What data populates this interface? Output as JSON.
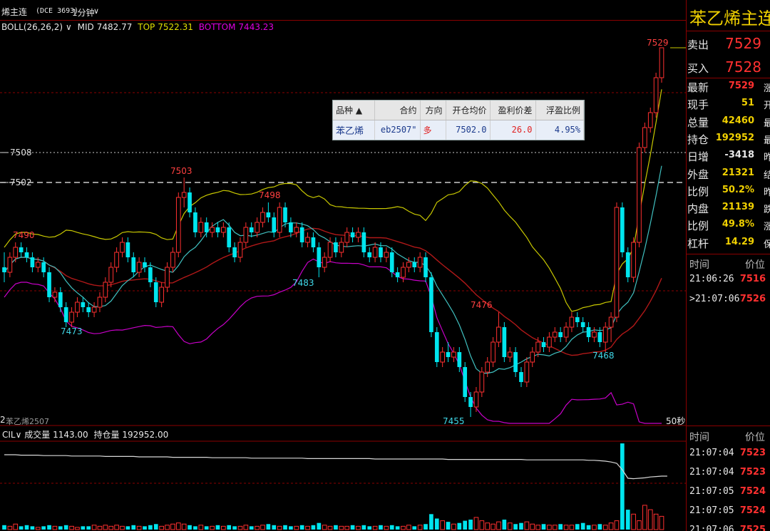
{
  "header": {
    "title": "烯主连",
    "code": "(DCE 3693)",
    "period": "1分钟",
    "chevron": "∨"
  },
  "indicators": {
    "boll_name": "BOLL(26,26,2)",
    "boll_chev": "∨",
    "mid_label": "MID",
    "mid_value": "7482.77",
    "top_label": "TOP",
    "top_value": "7522.31",
    "bottom_label": "BOTTOM",
    "bottom_value": "7443.23"
  },
  "price_levels": {
    "line1": "7508",
    "line2": "7502"
  },
  "annotations": {
    "a7503": "7503",
    "a7498": "7498",
    "a7490": "7490",
    "a7483": "7483",
    "a7476": "7476",
    "a7473": "7473",
    "a7468": "7468",
    "a7455": "7455",
    "a7529": "7529"
  },
  "chart_footer": {
    "left_label": "苯乙烯2507",
    "left_prefix": "2",
    "right_label": "50秒"
  },
  "volume_panel": {
    "prefix": "CIL∨",
    "vol_label": "成交量",
    "vol_value": "1143.00",
    "oi_label": "持仓量",
    "oi_value": "192952.00"
  },
  "position_table": {
    "headers": [
      "品种 ▲",
      "合约",
      "方向",
      "开仓均价",
      "盈利价差",
      "浮盈比例"
    ],
    "row": [
      "苯乙烯",
      "eb2507\"",
      "多",
      "7502.0",
      "26.0",
      "4.95%"
    ]
  },
  "quote_panel": {
    "title": "苯乙烯主连",
    "sell_label": "卖出",
    "sell_price": "7529",
    "buy_label": "买入",
    "buy_price": "7528",
    "rows": [
      {
        "label": "最新",
        "value": "7529",
        "cut": "涨"
      },
      {
        "label": "现手",
        "value": "51",
        "cut": "开"
      },
      {
        "label": "总量",
        "value": "42460",
        "cut": "最"
      },
      {
        "label": "持仓",
        "value": "192952",
        "cut": "最"
      },
      {
        "label": "日增",
        "value": "-3418",
        "cut": "昨"
      },
      {
        "label": "外盘",
        "value": "21321",
        "cut": "结"
      },
      {
        "label": "比例",
        "value": "50.2%",
        "cut": "昨"
      },
      {
        "label": "内盘",
        "value": "21139",
        "cut": "跌"
      },
      {
        "label": "比例",
        "value": "49.8%",
        "cut": "涨"
      },
      {
        "label": "杠杆",
        "value": "14.29",
        "cut": "保"
      }
    ],
    "tick_header": {
      "time": "时间",
      "price": "价位"
    },
    "ticks_top": [
      {
        "time": "21:06:26",
        "price": "7516"
      },
      {
        "time": ">21:07:06",
        "price": "7526"
      }
    ],
    "tick_header2": {
      "time": "时间",
      "price": "价位"
    },
    "ticks_bottom": [
      {
        "time": "21:07:04",
        "price": "7523"
      },
      {
        "time": "21:07:04",
        "price": "7523"
      },
      {
        "time": "21:07:05",
        "price": "7524"
      },
      {
        "time": "21:07:05",
        "price": "7524"
      },
      {
        "time": "21:07:06",
        "price": "7525"
      }
    ]
  },
  "colors": {
    "up": "#ff3030",
    "down": "#00e5ee",
    "mid": "#b01818",
    "top_band": "#c8c800",
    "bottom_band": "#c800c8",
    "fast_ma": "#40c0c0",
    "grid": "#8b0000"
  },
  "chart_data": {
    "type": "candlestick",
    "period": "1分钟",
    "candles": [
      [
        7485,
        7484,
        7488,
        7482
      ],
      [
        7484,
        7487,
        7488,
        7483
      ],
      [
        7487,
        7489,
        7490,
        7486
      ],
      [
        7489,
        7488,
        7490,
        7487
      ],
      [
        7488,
        7487,
        7489,
        7486
      ],
      [
        7487,
        7485,
        7488,
        7484
      ],
      [
        7485,
        7486,
        7487,
        7484
      ],
      [
        7486,
        7484,
        7487,
        7483
      ],
      [
        7484,
        7479,
        7485,
        7478
      ],
      [
        7479,
        7480,
        7481,
        7478
      ],
      [
        7480,
        7477,
        7481,
        7476
      ],
      [
        7477,
        7474,
        7478,
        7473
      ],
      [
        7474,
        7476,
        7477,
        7473
      ],
      [
        7476,
        7478,
        7479,
        7475
      ],
      [
        7478,
        7477,
        7479,
        7476
      ],
      [
        7477,
        7476,
        7478,
        7475
      ],
      [
        7476,
        7477,
        7478,
        7475
      ],
      [
        7477,
        7479,
        7480,
        7476
      ],
      [
        7479,
        7482,
        7483,
        7478
      ],
      [
        7482,
        7485,
        7486,
        7481
      ],
      [
        7485,
        7488,
        7489,
        7484
      ],
      [
        7488,
        7490,
        7491,
        7487
      ],
      [
        7490,
        7487,
        7491,
        7486
      ],
      [
        7487,
        7484,
        7488,
        7483
      ],
      [
        7484,
        7486,
        7487,
        7483
      ],
      [
        7486,
        7485,
        7487,
        7484
      ],
      [
        7485,
        7482,
        7486,
        7481
      ],
      [
        7482,
        7478,
        7483,
        7477
      ],
      [
        7478,
        7481,
        7482,
        7477
      ],
      [
        7481,
        7485,
        7486,
        7480
      ],
      [
        7485,
        7488,
        7489,
        7484
      ],
      [
        7488,
        7499,
        7500,
        7487
      ],
      [
        7499,
        7500,
        7503,
        7497
      ],
      [
        7500,
        7496,
        7501,
        7495
      ],
      [
        7496,
        7492,
        7497,
        7491
      ],
      [
        7492,
        7494,
        7495,
        7491
      ],
      [
        7494,
        7492,
        7495,
        7491
      ],
      [
        7492,
        7493,
        7494,
        7491
      ],
      [
        7493,
        7492,
        7494,
        7491
      ],
      [
        7492,
        7493,
        7494,
        7491
      ],
      [
        7493,
        7489,
        7494,
        7488
      ],
      [
        7489,
        7487,
        7490,
        7486
      ],
      [
        7487,
        7490,
        7491,
        7486
      ],
      [
        7490,
        7493,
        7494,
        7489
      ],
      [
        7493,
        7492,
        7494,
        7491
      ],
      [
        7492,
        7494,
        7495,
        7491
      ],
      [
        7494,
        7496,
        7497,
        7493
      ],
      [
        7496,
        7495,
        7498,
        7494
      ],
      [
        7495,
        7492,
        7496,
        7491
      ],
      [
        7492,
        7497,
        7498,
        7491
      ],
      [
        7497,
        7494,
        7498,
        7493
      ],
      [
        7494,
        7492,
        7495,
        7491
      ],
      [
        7492,
        7493,
        7494,
        7491
      ],
      [
        7493,
        7490,
        7494,
        7489
      ],
      [
        7490,
        7491,
        7492,
        7489
      ],
      [
        7491,
        7489,
        7492,
        7488
      ],
      [
        7489,
        7485,
        7490,
        7483
      ],
      [
        7485,
        7487,
        7488,
        7484
      ],
      [
        7487,
        7490,
        7491,
        7486
      ],
      [
        7490,
        7488,
        7491,
        7487
      ],
      [
        7488,
        7490,
        7491,
        7487
      ],
      [
        7490,
        7492,
        7493,
        7489
      ],
      [
        7492,
        7491,
        7493,
        7490
      ],
      [
        7491,
        7492,
        7493,
        7490
      ],
      [
        7492,
        7488,
        7493,
        7487
      ],
      [
        7488,
        7487,
        7489,
        7486
      ],
      [
        7487,
        7489,
        7490,
        7486
      ],
      [
        7489,
        7487,
        7490,
        7486
      ],
      [
        7487,
        7488,
        7489,
        7486
      ],
      [
        7488,
        7484,
        7489,
        7483
      ],
      [
        7484,
        7483,
        7485,
        7482
      ],
      [
        7483,
        7485,
        7486,
        7482
      ],
      [
        7485,
        7486,
        7487,
        7484
      ],
      [
        7486,
        7485,
        7487,
        7484
      ],
      [
        7485,
        7487,
        7488,
        7484
      ],
      [
        7487,
        7483,
        7488,
        7482
      ],
      [
        7483,
        7472,
        7484,
        7471
      ],
      [
        7472,
        7466,
        7473,
        7465
      ],
      [
        7466,
        7468,
        7469,
        7465
      ],
      [
        7468,
        7467,
        7470,
        7466
      ],
      [
        7467,
        7468,
        7469,
        7466
      ],
      [
        7468,
        7465,
        7469,
        7464
      ],
      [
        7465,
        7459,
        7466,
        7458
      ],
      [
        7459,
        7457,
        7460,
        7455
      ],
      [
        7457,
        7460,
        7461,
        7456
      ],
      [
        7460,
        7464,
        7465,
        7459
      ],
      [
        7464,
        7466,
        7467,
        7463
      ],
      [
        7466,
        7470,
        7471,
        7465
      ],
      [
        7470,
        7473,
        7476,
        7469
      ],
      [
        7473,
        7467,
        7474,
        7466
      ],
      [
        7467,
        7468,
        7469,
        7466
      ],
      [
        7468,
        7464,
        7469,
        7463
      ],
      [
        7464,
        7462,
        7465,
        7461
      ],
      [
        7462,
        7466,
        7467,
        7461
      ],
      [
        7466,
        7468,
        7469,
        7465
      ],
      [
        7468,
        7470,
        7471,
        7467
      ],
      [
        7470,
        7469,
        7471,
        7468
      ],
      [
        7469,
        7471,
        7472,
        7468
      ],
      [
        7471,
        7472,
        7473,
        7470
      ],
      [
        7472,
        7471,
        7473,
        7470
      ],
      [
        7471,
        7473,
        7474,
        7470
      ],
      [
        7473,
        7475,
        7476,
        7472
      ],
      [
        7475,
        7474,
        7476,
        7473
      ],
      [
        7474,
        7473,
        7475,
        7472
      ],
      [
        7473,
        7471,
        7474,
        7470
      ],
      [
        7471,
        7472,
        7473,
        7470
      ],
      [
        7472,
        7470,
        7473,
        7469
      ],
      [
        7470,
        7473,
        7474,
        7468
      ],
      [
        7473,
        7475,
        7476,
        7470
      ],
      [
        7475,
        7497,
        7498,
        7474
      ],
      [
        7497,
        7488,
        7498,
        7487
      ],
      [
        7488,
        7483,
        7489,
        7482
      ],
      [
        7483,
        7490,
        7491,
        7482
      ],
      [
        7490,
        7509,
        7510,
        7489
      ],
      [
        7509,
        7513,
        7514,
        7508
      ],
      [
        7513,
        7516,
        7517,
        7512
      ],
      [
        7516,
        7523,
        7524,
        7515
      ],
      [
        7523,
        7529,
        7529,
        7522
      ]
    ],
    "band_labels": {
      "mid": "MID",
      "top": "TOP",
      "bottom": "BOTTOM"
    },
    "volume_bars": [
      4,
      3,
      5,
      3,
      4,
      3,
      2,
      3,
      4,
      3,
      3,
      4,
      3,
      2,
      3,
      3,
      4,
      3,
      4,
      3,
      4,
      3,
      3,
      4,
      3,
      3,
      4,
      5,
      3,
      4,
      5,
      6,
      5,
      4,
      3,
      4,
      3,
      3,
      4,
      3,
      4,
      3,
      3,
      4,
      3,
      3,
      4,
      5,
      4,
      3,
      4,
      3,
      3,
      4,
      3,
      4,
      6,
      4,
      3,
      4,
      3,
      3,
      4,
      3,
      4,
      3,
      3,
      4,
      3,
      4,
      3,
      3,
      4,
      3,
      4,
      5,
      14,
      10,
      8,
      7,
      5,
      6,
      8,
      9,
      11,
      8,
      6,
      5,
      7,
      9,
      6,
      5,
      6,
      7,
      5,
      4,
      5,
      4,
      4,
      5,
      4,
      4,
      5,
      6,
      4,
      4,
      5,
      4,
      6,
      8,
      78,
      18,
      14,
      8,
      22,
      18,
      14,
      12,
      10
    ],
    "oi_line": [
      0.3,
      0.3,
      0.3,
      0.31,
      0.31,
      0.31,
      0.31,
      0.32,
      0.32,
      0.32,
      0.32,
      0.32,
      0.33,
      0.33,
      0.33,
      0.33,
      0.33,
      0.33,
      0.34,
      0.34,
      0.34,
      0.34,
      0.34,
      0.34,
      0.35,
      0.35,
      0.35,
      0.35,
      0.35,
      0.35,
      0.36,
      0.36,
      0.36,
      0.36,
      0.36,
      0.36,
      0.36,
      0.37,
      0.37,
      0.37,
      0.37,
      0.37,
      0.37,
      0.37,
      0.38,
      0.38,
      0.38,
      0.38,
      0.38,
      0.38,
      0.38,
      0.38,
      0.38,
      0.38,
      0.39,
      0.39,
      0.39,
      0.39,
      0.39,
      0.39,
      0.39,
      0.39,
      0.39,
      0.39,
      0.39,
      0.39,
      0.4,
      0.4,
      0.4,
      0.4,
      0.4,
      0.4,
      0.4,
      0.4,
      0.4,
      0.4,
      0.4,
      0.4,
      0.4,
      0.41,
      0.41,
      0.41,
      0.41,
      0.41,
      0.41,
      0.41,
      0.41,
      0.41,
      0.41,
      0.41,
      0.41,
      0.41,
      0.41,
      0.42,
      0.42,
      0.42,
      0.42,
      0.42,
      0.42,
      0.42,
      0.42,
      0.42,
      0.42,
      0.42,
      0.43,
      0.43,
      0.44,
      0.45,
      0.47,
      0.5,
      0.65,
      0.85,
      0.86,
      0.85,
      0.84,
      0.82,
      0.81,
      0.8,
      0.8
    ]
  }
}
